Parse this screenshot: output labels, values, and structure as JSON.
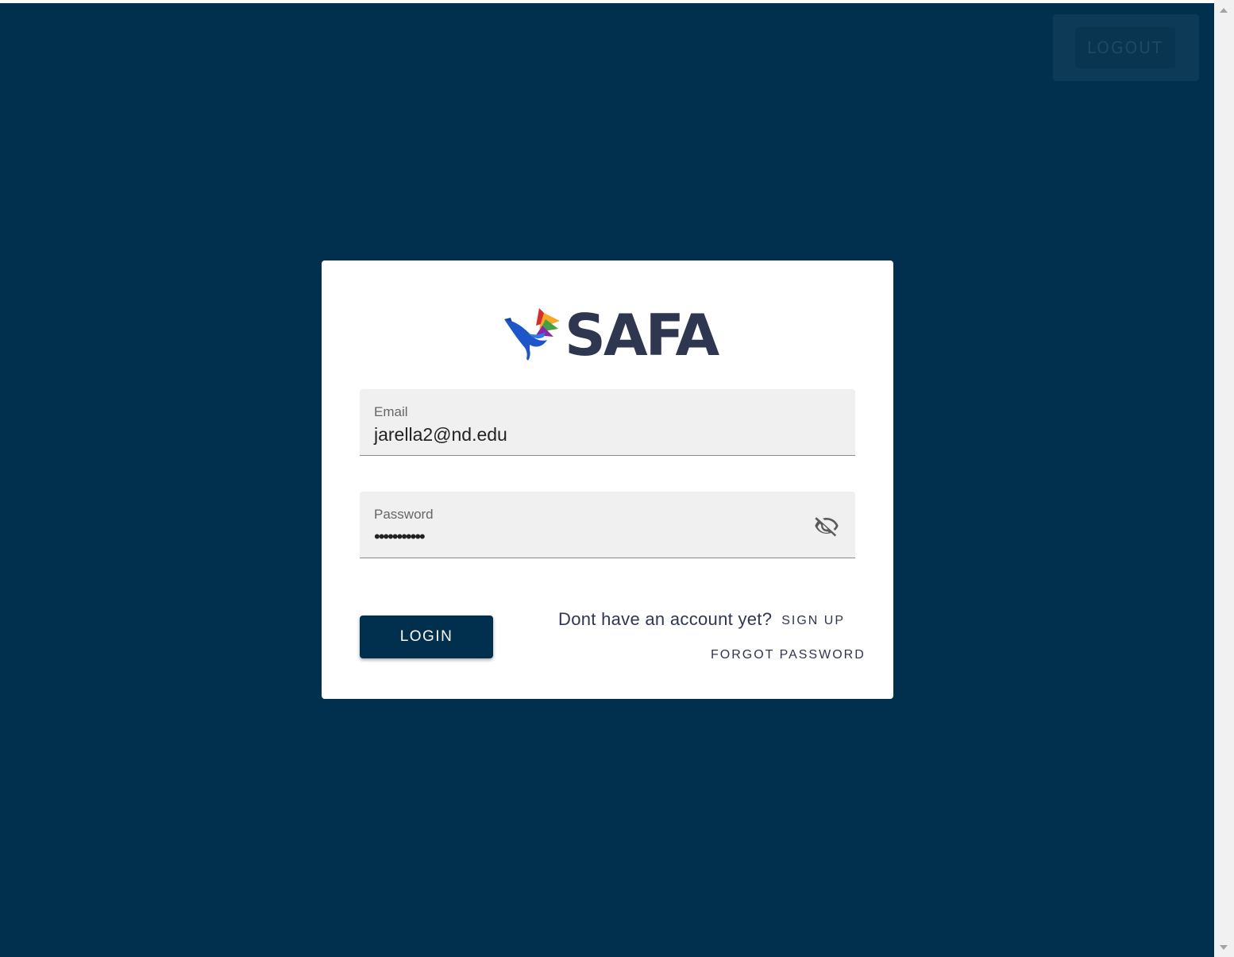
{
  "app": {
    "name": "SAFA",
    "colors": {
      "background": "#00304d",
      "card": "#ffffff",
      "primary_button": "#00304d",
      "text_dark": "#2f3650",
      "field_bg": "#f0f0f0"
    }
  },
  "header": {
    "logout_label": "LOGOUT"
  },
  "login_form": {
    "logo": {
      "text": "SAFA",
      "icon": "bird-logo-icon"
    },
    "email": {
      "label": "Email",
      "value": "jarella2@nd.edu"
    },
    "password": {
      "label": "Password",
      "value": "•••••••••••",
      "toggle_icon": "eye-off-icon"
    },
    "login_label": "LOGIN",
    "no_account_text": "Dont have an account yet?",
    "signup_label": "SIGN UP",
    "forgot_password_label": "FORGOT PASSWORD"
  }
}
